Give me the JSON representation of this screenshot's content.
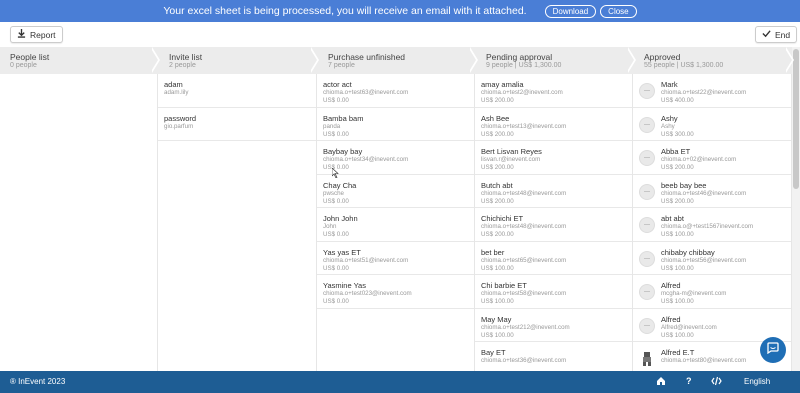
{
  "banner": {
    "message": "Your excel sheet is being processed, you will receive an email with it attached.",
    "download_label": "Download",
    "close_label": "Close"
  },
  "toolbar": {
    "report_label": "Report",
    "end_label": "End"
  },
  "columns": [
    {
      "title": "People list",
      "subtitle": "0 people",
      "cards": []
    },
    {
      "title": "Invite list",
      "subtitle": "2 people",
      "cards": [
        {
          "name": "adam",
          "email": "adam.lily"
        },
        {
          "name": "password",
          "email": "gio.parfum"
        }
      ]
    },
    {
      "title": "Purchase unfinished",
      "subtitle": "7 people",
      "cards": [
        {
          "name": "actor act",
          "email": "chioma.o+test63@inevent.com",
          "price": "US$ 0.00"
        },
        {
          "name": "Bamba bam",
          "email": "panda",
          "price": "US$ 0.00"
        },
        {
          "name": "Baybay bay",
          "email": "chioma.o+test34@inevent.com",
          "price": "US$ 0.00"
        },
        {
          "name": "Chay Cha",
          "email": "pwsche",
          "price": "US$ 0.00"
        },
        {
          "name": "John John",
          "email": "John",
          "price": "US$ 0.00"
        },
        {
          "name": "Yas yas ET",
          "email": "chioma.o+test51@inevent.com",
          "price": "US$ 0.00"
        },
        {
          "name": "Yasmine Yas",
          "email": "chioma.o+test023@inevent.com",
          "price": "US$ 0.00"
        }
      ]
    },
    {
      "title": "Pending approval",
      "subtitle": "9 people | US$ 1,300.00",
      "cards": [
        {
          "name": "amay amalia",
          "email": "chioma.o+test2@inevent.com",
          "price": "US$ 200.00"
        },
        {
          "name": "Ash Bee",
          "email": "chioma.o+test13@inevent.com",
          "price": "US$ 200.00"
        },
        {
          "name": "Bert Lisvan Reyes",
          "email": "lisvan.r@inevent.com",
          "price": "US$ 200.00"
        },
        {
          "name": "Butch abt",
          "email": "chioma.o+test48@inevent.com",
          "price": "US$ 200.00"
        },
        {
          "name": "Chichichi ET",
          "email": "chioma.o+test48@inevent.com",
          "price": "US$ 200.00"
        },
        {
          "name": "bet ber",
          "email": "chioma.o+test65@inevent.com",
          "price": "US$ 100.00"
        },
        {
          "name": "Chi barbie ET",
          "email": "chioma.o+test58@inevent.com",
          "price": "US$ 100.00"
        },
        {
          "name": "May May",
          "email": "chioma.o+test212@inevent.com",
          "price": "US$ 100.00"
        },
        {
          "name": "Bay ET",
          "email": "chioma.o+test36@inevent.com",
          "price": ""
        }
      ]
    },
    {
      "title": "Approved",
      "subtitle": "55 people | US$ 1,300.00",
      "cards": [
        {
          "name": "Mark",
          "email": "chioma.o+test22@inevent.com",
          "price": "US$ 400.00"
        },
        {
          "name": "Ashy",
          "email": "Ashy",
          "price": "US$ 300.00"
        },
        {
          "name": "Abba ET",
          "email": "chioma.o+02@inevent.com",
          "price": "US$ 200.00"
        },
        {
          "name": "beeb bay bee",
          "email": "chioma.o+test46@inevent.com",
          "price": "US$ 200.00"
        },
        {
          "name": "abt abt",
          "email": "chioma.o@+test1567inevent.com",
          "price": "US$ 100.00"
        },
        {
          "name": "chibaby chibbay",
          "email": "chioma.o+test56@inevent.com",
          "price": "US$ 100.00"
        },
        {
          "name": "Alfred",
          "email": "mcgha-m@inevent.com",
          "price": "US$ 100.00"
        },
        {
          "name": "Alfred",
          "email": "Alfred@inevent.com",
          "price": "US$ 100.00"
        },
        {
          "name": "Alfred E.T",
          "email": "chioma.o+test80@inevent.com",
          "price": ""
        }
      ]
    }
  ],
  "footer": {
    "copyright": "® InEvent 2023",
    "language": "English"
  },
  "colors": {
    "banner": "#4a7ed6",
    "footer": "#1e5d94",
    "chat": "#1f6eb5"
  }
}
